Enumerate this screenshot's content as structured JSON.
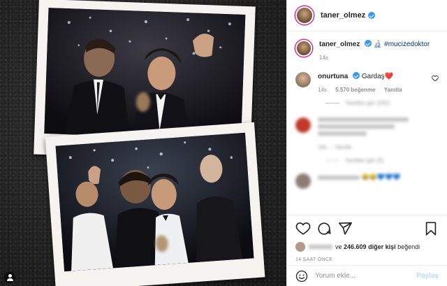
{
  "post": {
    "author": "taner_olmez",
    "verified": true
  },
  "caption": {
    "username": "taner_olmez",
    "emoji": "🔬",
    "hashtag": "#mucizedoktor",
    "age": "14s"
  },
  "top_comment": {
    "username": "onurtuna",
    "text": "Gardaş",
    "emoji": "❤️",
    "age": "14s",
    "likes": "5.570 beğenme",
    "reply_label": "Yanıtla",
    "view_replies": "Yanıtları gör (242)"
  },
  "blurred_comments": [
    {
      "lines": 3,
      "meta": "14s  ...  Yanıtla",
      "replies": "Yanıtları gör (3)"
    },
    {
      "lines": 1,
      "emoji": "😂😂💙💙💙"
    }
  ],
  "likes_summary": {
    "prefix": "ve",
    "count": "246.609",
    "suffix": "diğer kişi",
    "verb": "beğendi"
  },
  "time_ago": "14 SAAT ÖNCE",
  "composer": {
    "placeholder": "Yorum ekle...",
    "post_label": "Paylaş"
  },
  "colors": {
    "accent": "#3897f0",
    "link": "#00376b",
    "muted": "#8e8e8e",
    "post_disabled": "#b2dffc"
  },
  "icons": [
    "heart-icon",
    "comment-icon",
    "share-icon",
    "bookmark-icon",
    "emoji-icon",
    "user-tag-icon"
  ]
}
